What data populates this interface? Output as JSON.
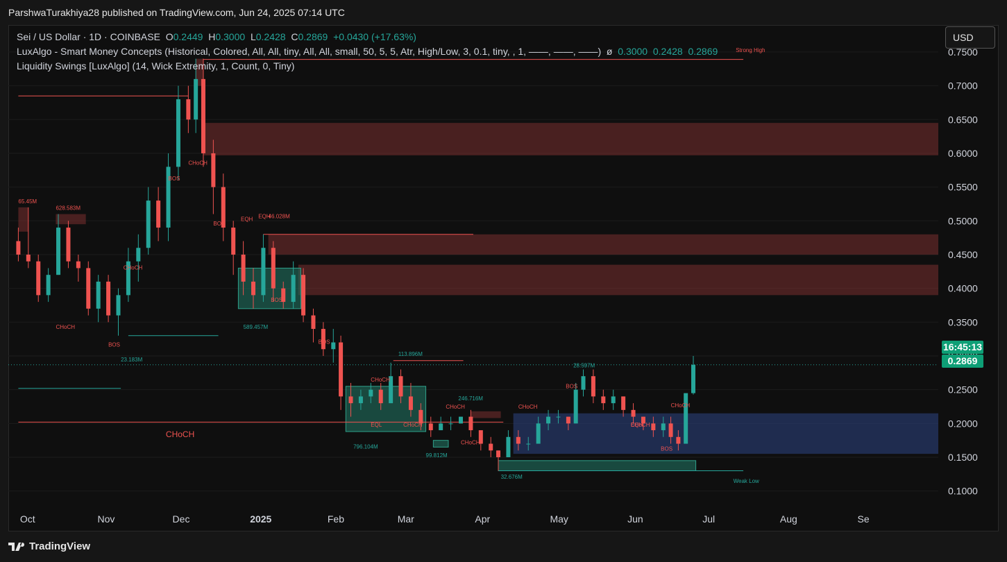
{
  "header": {
    "published": "ParshwaTurakhiya28 published on TradingView.com, Jun 24, 2025 07:14 UTC"
  },
  "legend": {
    "symbol": "Sei / US Dollar · 1D · COINBASE",
    "o_label": "O",
    "o": "0.2449",
    "h_label": "H",
    "h": "0.3000",
    "l_label": "L",
    "l": "0.2428",
    "c_label": "C",
    "c": "0.2869",
    "change": "+0.0430 (+17.63%)",
    "indicator1": "LuxAlgo - Smart Money Concepts (Historical, Colored, All, All, tiny, All, All, small, 50, 5, 5, Atr, High/Low, 3, 0.1, tiny, , 1, ——, ——, ——)",
    "indicator1_glyph": "ø",
    "indicator1_values": "0.3000  0.2428  0.2869",
    "indicator2": "Liquidity Swings [LuxAlgo] (14, Wick Extremity, 1, Count, 0, Tiny)"
  },
  "currency_button": "USD",
  "price_tags": {
    "countdown": "16:45:13",
    "last": "0.2869"
  },
  "footer": {
    "brand": "TradingView"
  },
  "colors": {
    "up": "#26a69a",
    "down": "#ef5350",
    "bg": "#0f0f0f",
    "zone_red": "#7a2f2f",
    "zone_blue": "#2a3f7a",
    "zone_green": "#1f6f5f"
  },
  "chart_data": {
    "type": "candlestick",
    "symbol": "Sei / US Dollar",
    "timeframe": "1D",
    "x_ticks": [
      "Oct",
      "Nov",
      "Dec",
      "2025",
      "Feb",
      "Mar",
      "Apr",
      "May",
      "Jun",
      "Jul",
      "Aug",
      "Se"
    ],
    "y_ticks": [
      "0.7500",
      "0.7000",
      "0.6500",
      "0.6000",
      "0.5500",
      "0.5000",
      "0.4500",
      "0.4000",
      "0.3500",
      "0.3000",
      "0.2500",
      "0.2000",
      "0.1500",
      "0.1000"
    ],
    "ylim": [
      0.075,
      0.79
    ],
    "last_price": 0.2869,
    "series": [
      {
        "ohlc": [
          {
            "date": "2024-09-27",
            "o": 0.47,
            "h": 0.49,
            "l": 0.44,
            "c": 0.45
          },
          {
            "date": "2024-10-01",
            "o": 0.45,
            "h": 0.52,
            "l": 0.43,
            "c": 0.44
          },
          {
            "date": "2024-10-05",
            "o": 0.44,
            "h": 0.45,
            "l": 0.38,
            "c": 0.39
          },
          {
            "date": "2024-10-09",
            "o": 0.39,
            "h": 0.43,
            "l": 0.38,
            "c": 0.42
          },
          {
            "date": "2024-10-13",
            "o": 0.42,
            "h": 0.51,
            "l": 0.42,
            "c": 0.49
          },
          {
            "date": "2024-10-17",
            "o": 0.49,
            "h": 0.5,
            "l": 0.43,
            "c": 0.44
          },
          {
            "date": "2024-10-21",
            "o": 0.44,
            "h": 0.45,
            "l": 0.41,
            "c": 0.43
          },
          {
            "date": "2024-10-25",
            "o": 0.43,
            "h": 0.44,
            "l": 0.36,
            "c": 0.37
          },
          {
            "date": "2024-10-29",
            "o": 0.37,
            "h": 0.42,
            "l": 0.35,
            "c": 0.41
          },
          {
            "date": "2024-11-02",
            "o": 0.41,
            "h": 0.42,
            "l": 0.35,
            "c": 0.36
          },
          {
            "date": "2024-11-06",
            "o": 0.36,
            "h": 0.4,
            "l": 0.33,
            "c": 0.39
          },
          {
            "date": "2024-11-10",
            "o": 0.39,
            "h": 0.46,
            "l": 0.38,
            "c": 0.44
          },
          {
            "date": "2024-11-14",
            "o": 0.44,
            "h": 0.48,
            "l": 0.41,
            "c": 0.46
          },
          {
            "date": "2024-11-18",
            "o": 0.46,
            "h": 0.55,
            "l": 0.45,
            "c": 0.53
          },
          {
            "date": "2024-11-22",
            "o": 0.53,
            "h": 0.55,
            "l": 0.47,
            "c": 0.49
          },
          {
            "date": "2024-11-26",
            "o": 0.49,
            "h": 0.6,
            "l": 0.47,
            "c": 0.58
          },
          {
            "date": "2024-11-30",
            "o": 0.58,
            "h": 0.7,
            "l": 0.56,
            "c": 0.68
          },
          {
            "date": "2024-12-04",
            "o": 0.68,
            "h": 0.7,
            "l": 0.63,
            "c": 0.65
          },
          {
            "date": "2024-12-07",
            "o": 0.65,
            "h": 0.74,
            "l": 0.63,
            "c": 0.71
          },
          {
            "date": "2024-12-10",
            "o": 0.71,
            "h": 0.74,
            "l": 0.58,
            "c": 0.6
          },
          {
            "date": "2024-12-14",
            "o": 0.6,
            "h": 0.62,
            "l": 0.51,
            "c": 0.55
          },
          {
            "date": "2024-12-18",
            "o": 0.55,
            "h": 0.57,
            "l": 0.47,
            "c": 0.49
          },
          {
            "date": "2024-12-22",
            "o": 0.49,
            "h": 0.5,
            "l": 0.42,
            "c": 0.45
          },
          {
            "date": "2024-12-26",
            "o": 0.45,
            "h": 0.47,
            "l": 0.39,
            "c": 0.41
          },
          {
            "date": "2024-12-30",
            "o": 0.41,
            "h": 0.43,
            "l": 0.37,
            "c": 0.39
          },
          {
            "date": "2025-01-03",
            "o": 0.39,
            "h": 0.48,
            "l": 0.38,
            "c": 0.46
          },
          {
            "date": "2025-01-07",
            "o": 0.46,
            "h": 0.47,
            "l": 0.38,
            "c": 0.4
          },
          {
            "date": "2025-01-11",
            "o": 0.4,
            "h": 0.41,
            "l": 0.37,
            "c": 0.38
          },
          {
            "date": "2025-01-15",
            "o": 0.38,
            "h": 0.44,
            "l": 0.37,
            "c": 0.42
          },
          {
            "date": "2025-01-19",
            "o": 0.42,
            "h": 0.43,
            "l": 0.35,
            "c": 0.36
          },
          {
            "date": "2025-01-23",
            "o": 0.36,
            "h": 0.37,
            "l": 0.32,
            "c": 0.34
          },
          {
            "date": "2025-01-27",
            "o": 0.34,
            "h": 0.35,
            "l": 0.3,
            "c": 0.31
          },
          {
            "date": "2025-01-31",
            "o": 0.31,
            "h": 0.34,
            "l": 0.29,
            "c": 0.32
          },
          {
            "date": "2025-02-03",
            "o": 0.32,
            "h": 0.33,
            "l": 0.22,
            "c": 0.24
          },
          {
            "date": "2025-02-07",
            "o": 0.24,
            "h": 0.26,
            "l": 0.21,
            "c": 0.23
          },
          {
            "date": "2025-02-11",
            "o": 0.23,
            "h": 0.25,
            "l": 0.22,
            "c": 0.24
          },
          {
            "date": "2025-02-15",
            "o": 0.24,
            "h": 0.26,
            "l": 0.23,
            "c": 0.25
          },
          {
            "date": "2025-02-19",
            "o": 0.25,
            "h": 0.26,
            "l": 0.22,
            "c": 0.23
          },
          {
            "date": "2025-02-23",
            "o": 0.23,
            "h": 0.29,
            "l": 0.23,
            "c": 0.27
          },
          {
            "date": "2025-02-27",
            "o": 0.27,
            "h": 0.28,
            "l": 0.23,
            "c": 0.24
          },
          {
            "date": "2025-03-03",
            "o": 0.24,
            "h": 0.26,
            "l": 0.21,
            "c": 0.22
          },
          {
            "date": "2025-03-07",
            "o": 0.22,
            "h": 0.23,
            "l": 0.19,
            "c": 0.2
          },
          {
            "date": "2025-03-11",
            "o": 0.2,
            "h": 0.21,
            "l": 0.18,
            "c": 0.19
          },
          {
            "date": "2025-03-15",
            "o": 0.19,
            "h": 0.21,
            "l": 0.19,
            "c": 0.2
          },
          {
            "date": "2025-03-19",
            "o": 0.2,
            "h": 0.21,
            "l": 0.19,
            "c": 0.2
          },
          {
            "date": "2025-03-23",
            "o": 0.2,
            "h": 0.21,
            "l": 0.2,
            "c": 0.21
          },
          {
            "date": "2025-03-27",
            "o": 0.21,
            "h": 0.22,
            "l": 0.18,
            "c": 0.19
          },
          {
            "date": "2025-03-31",
            "o": 0.19,
            "h": 0.19,
            "l": 0.16,
            "c": 0.17
          },
          {
            "date": "2025-04-04",
            "o": 0.17,
            "h": 0.18,
            "l": 0.15,
            "c": 0.16
          },
          {
            "date": "2025-04-07",
            "o": 0.16,
            "h": 0.16,
            "l": 0.13,
            "c": 0.15
          },
          {
            "date": "2025-04-11",
            "o": 0.15,
            "h": 0.19,
            "l": 0.15,
            "c": 0.18
          },
          {
            "date": "2025-04-15",
            "o": 0.18,
            "h": 0.19,
            "l": 0.16,
            "c": 0.17
          },
          {
            "date": "2025-04-19",
            "o": 0.17,
            "h": 0.18,
            "l": 0.16,
            "c": 0.17
          },
          {
            "date": "2025-04-23",
            "o": 0.17,
            "h": 0.21,
            "l": 0.17,
            "c": 0.2
          },
          {
            "date": "2025-04-27",
            "o": 0.2,
            "h": 0.22,
            "l": 0.19,
            "c": 0.21
          },
          {
            "date": "2025-05-01",
            "o": 0.21,
            "h": 0.22,
            "l": 0.2,
            "c": 0.21
          },
          {
            "date": "2025-05-05",
            "o": 0.21,
            "h": 0.21,
            "l": 0.19,
            "c": 0.2
          },
          {
            "date": "2025-05-08",
            "o": 0.2,
            "h": 0.26,
            "l": 0.2,
            "c": 0.25
          },
          {
            "date": "2025-05-11",
            "o": 0.25,
            "h": 0.28,
            "l": 0.24,
            "c": 0.27
          },
          {
            "date": "2025-05-15",
            "o": 0.27,
            "h": 0.28,
            "l": 0.23,
            "c": 0.24
          },
          {
            "date": "2025-05-19",
            "o": 0.24,
            "h": 0.25,
            "l": 0.22,
            "c": 0.23
          },
          {
            "date": "2025-05-23",
            "o": 0.23,
            "h": 0.25,
            "l": 0.22,
            "c": 0.24
          },
          {
            "date": "2025-05-27",
            "o": 0.24,
            "h": 0.24,
            "l": 0.21,
            "c": 0.22
          },
          {
            "date": "2025-05-31",
            "o": 0.22,
            "h": 0.23,
            "l": 0.2,
            "c": 0.21
          },
          {
            "date": "2025-06-04",
            "o": 0.21,
            "h": 0.21,
            "l": 0.19,
            "c": 0.2
          },
          {
            "date": "2025-06-08",
            "o": 0.2,
            "h": 0.21,
            "l": 0.18,
            "c": 0.19
          },
          {
            "date": "2025-06-12",
            "o": 0.19,
            "h": 0.21,
            "l": 0.18,
            "c": 0.2
          },
          {
            "date": "2025-06-15",
            "o": 0.2,
            "h": 0.21,
            "l": 0.17,
            "c": 0.18
          },
          {
            "date": "2025-06-18",
            "o": 0.18,
            "h": 0.19,
            "l": 0.16,
            "c": 0.17
          },
          {
            "date": "2025-06-21",
            "o": 0.17,
            "h": 0.24,
            "l": 0.17,
            "c": 0.2449
          },
          {
            "date": "2025-06-24",
            "o": 0.2449,
            "h": 0.3,
            "l": 0.2428,
            "c": 0.2869
          }
        ]
      }
    ],
    "zones": [
      {
        "kind": "supply",
        "from": "2024-12-10",
        "to": "2025-09-30",
        "top": 0.645,
        "bottom": 0.597
      },
      {
        "kind": "supply",
        "from": "2025-01-05",
        "to": "2025-09-30",
        "top": 0.48,
        "bottom": 0.45
      },
      {
        "kind": "supply",
        "from": "2025-01-17",
        "to": "2025-09-30",
        "top": 0.435,
        "bottom": 0.39
      },
      {
        "kind": "supply",
        "from": "2024-09-27",
        "to": "2024-10-01",
        "top": 0.52,
        "bottom": 0.484
      },
      {
        "kind": "supply",
        "from": "2024-10-12",
        "to": "2024-10-24",
        "top": 0.51,
        "bottom": 0.495
      },
      {
        "kind": "supply",
        "from": "2024-12-07",
        "to": "2024-12-10",
        "top": 0.74,
        "bottom": 0.7
      },
      {
        "kind": "supply",
        "from": "2025-03-27",
        "to": "2025-04-08",
        "top": 0.218,
        "bottom": 0.208
      },
      {
        "kind": "demand",
        "from": "2024-12-24",
        "to": "2025-01-18",
        "top": 0.43,
        "bottom": 0.37
      },
      {
        "kind": "demand",
        "from": "2025-02-05",
        "to": "2025-03-09",
        "top": 0.255,
        "bottom": 0.188
      },
      {
        "kind": "demand",
        "from": "2025-03-12",
        "to": "2025-03-18",
        "top": 0.175,
        "bottom": 0.165
      },
      {
        "kind": "demand",
        "from": "2025-04-07",
        "to": "2025-06-25",
        "top": 0.145,
        "bottom": 0.13
      },
      {
        "kind": "discount",
        "from": "2025-04-13",
        "to": "2025-09-30",
        "top": 0.215,
        "bottom": 0.155
      }
    ],
    "lines": [
      {
        "kind": "strong_high",
        "from": "2024-12-10",
        "to": "2025-07-14",
        "y": 0.739
      },
      {
        "kind": "weak_low",
        "from": "2025-04-07",
        "to": "2025-07-14",
        "y": 0.13
      },
      {
        "kind": "choch_major",
        "from": "2024-09-27",
        "to": "2025-04-09",
        "y": 0.202
      },
      {
        "kind": "liquidity_high",
        "from": "2025-01-03",
        "to": "2025-03-28",
        "y": 0.48
      },
      {
        "kind": "liquidity_high",
        "from": "2025-02-24",
        "to": "2025-03-24",
        "y": 0.293
      },
      {
        "kind": "liquidity_low",
        "from": "2024-11-10",
        "to": "2024-12-16",
        "y": 0.33
      },
      {
        "kind": "liquidity_high",
        "from": "2024-09-27",
        "to": "2024-12-04",
        "y": 0.685
      },
      {
        "kind": "liquidity_low",
        "from": "2024-09-27",
        "to": "2024-11-07",
        "y": 0.252
      }
    ],
    "annotations": [
      {
        "text": "Strong High",
        "date": "2025-07-11",
        "y": 0.75
      },
      {
        "text": "Weak Low",
        "date": "2025-07-10",
        "y": 0.112
      },
      {
        "text": "CHoCH",
        "date": "2024-11-25",
        "y": 0.18
      },
      {
        "text": "65.45M",
        "date": "2024-09-27",
        "y": 0.526
      },
      {
        "text": "628.583M",
        "date": "2024-10-12",
        "y": 0.516
      },
      {
        "text": "CHoCH",
        "date": "2024-10-12",
        "y": 0.34
      },
      {
        "text": "BOS",
        "date": "2024-11-02",
        "y": 0.314
      },
      {
        "text": "23.183M",
        "date": "2024-11-07",
        "y": 0.292
      },
      {
        "text": "CHoCH",
        "date": "2024-11-08",
        "y": 0.428
      },
      {
        "text": "BOS",
        "date": "2024-11-26",
        "y": 0.56
      },
      {
        "text": "CHoCH",
        "date": "2024-12-04",
        "y": 0.583
      },
      {
        "text": "BOS",
        "date": "2024-12-14",
        "y": 0.493
      },
      {
        "text": "EQH",
        "date": "2024-12-25",
        "y": 0.5
      },
      {
        "text": "EQH",
        "date": "2025-01-01",
        "y": 0.504
      },
      {
        "text": "46.028M",
        "date": "2025-01-05",
        "y": 0.504
      },
      {
        "text": "BOS",
        "date": "2025-01-06",
        "y": 0.38
      },
      {
        "text": "589.457M",
        "date": "2024-12-26",
        "y": 0.34
      },
      {
        "text": "BOS",
        "date": "2025-01-25",
        "y": 0.318
      },
      {
        "text": "113.896M",
        "date": "2025-02-26",
        "y": 0.3
      },
      {
        "text": "CHoCH",
        "date": "2025-02-15",
        "y": 0.262
      },
      {
        "text": "EQL",
        "date": "2025-02-15",
        "y": 0.195
      },
      {
        "text": "CHoCH",
        "date": "2025-02-28",
        "y": 0.195
      },
      {
        "text": "796.104M",
        "date": "2025-02-08",
        "y": 0.163
      },
      {
        "text": "99.812M",
        "date": "2025-03-09",
        "y": 0.15
      },
      {
        "text": "CHoCH",
        "date": "2025-03-17",
        "y": 0.222
      },
      {
        "text": "246.716M",
        "date": "2025-03-22",
        "y": 0.234
      },
      {
        "text": "CHoCH",
        "date": "2025-03-23",
        "y": 0.169
      },
      {
        "text": "CHoCH",
        "date": "2025-04-15",
        "y": 0.222
      },
      {
        "text": "32.676M",
        "date": "2025-04-08",
        "y": 0.118
      },
      {
        "text": "BOS",
        "date": "2025-05-04",
        "y": 0.252
      },
      {
        "text": "28.597M",
        "date": "2025-05-07",
        "y": 0.283
      },
      {
        "text": "EQH",
        "date": "2025-05-30",
        "y": 0.195
      },
      {
        "text": "CHoCH",
        "date": "2025-05-30",
        "y": 0.195
      },
      {
        "text": "BOS",
        "date": "2025-06-11",
        "y": 0.16
      },
      {
        "text": "CHoCH",
        "date": "2025-06-15",
        "y": 0.224
      }
    ]
  }
}
